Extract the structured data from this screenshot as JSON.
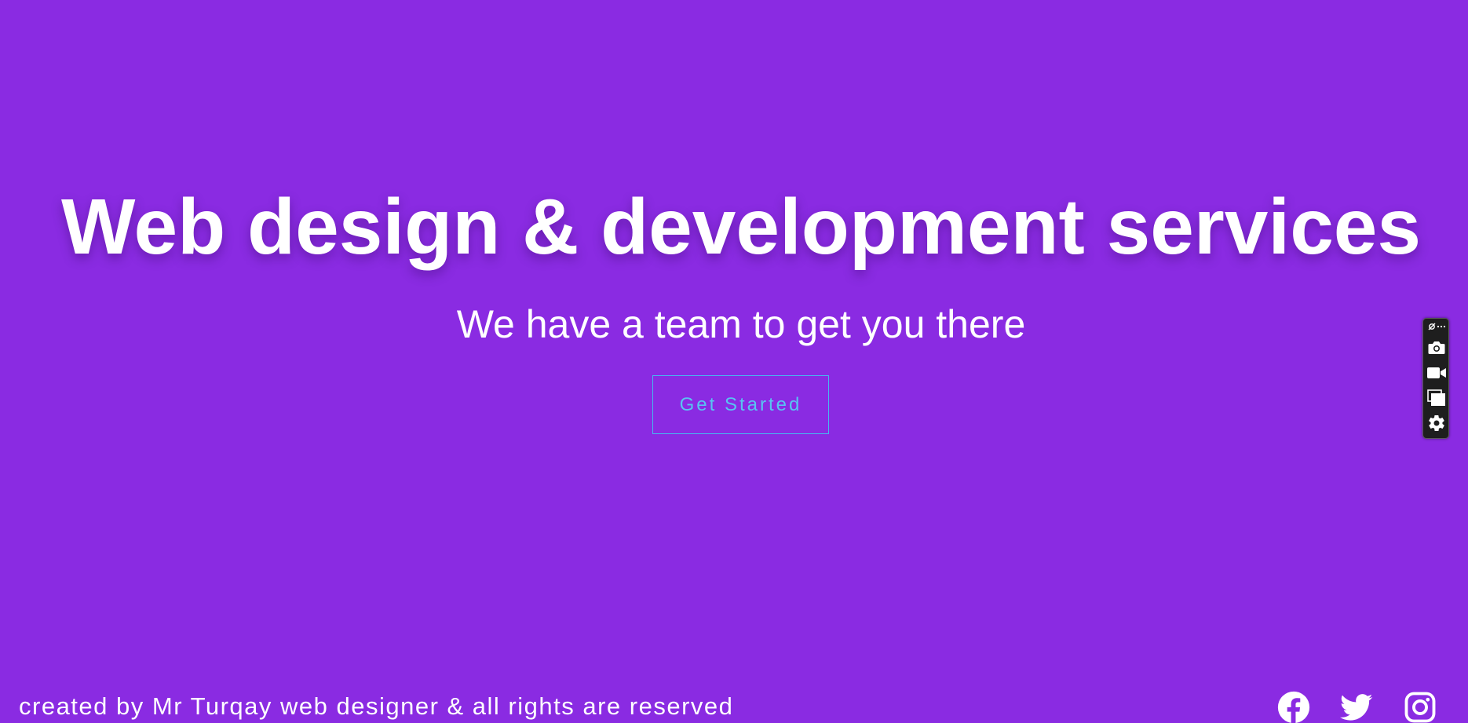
{
  "hero": {
    "headline": "Web design & development services",
    "subheadline": "We have a team to get you there",
    "cta_label": "Get Started",
    "background_color": "#8a2be2",
    "cta_color": "#58c4f2"
  },
  "footer": {
    "credit": "created by Mr Turqay web designer & all rights are reserved",
    "social": [
      {
        "name": "facebook",
        "icon": "facebook-icon"
      },
      {
        "name": "twitter",
        "icon": "twitter-icon"
      },
      {
        "name": "instagram",
        "icon": "instagram-icon"
      }
    ]
  },
  "capture_toolbar": {
    "items": [
      "link-more-icon",
      "camera-icon",
      "video-camera-icon",
      "windows-icon",
      "gear-icon"
    ]
  }
}
